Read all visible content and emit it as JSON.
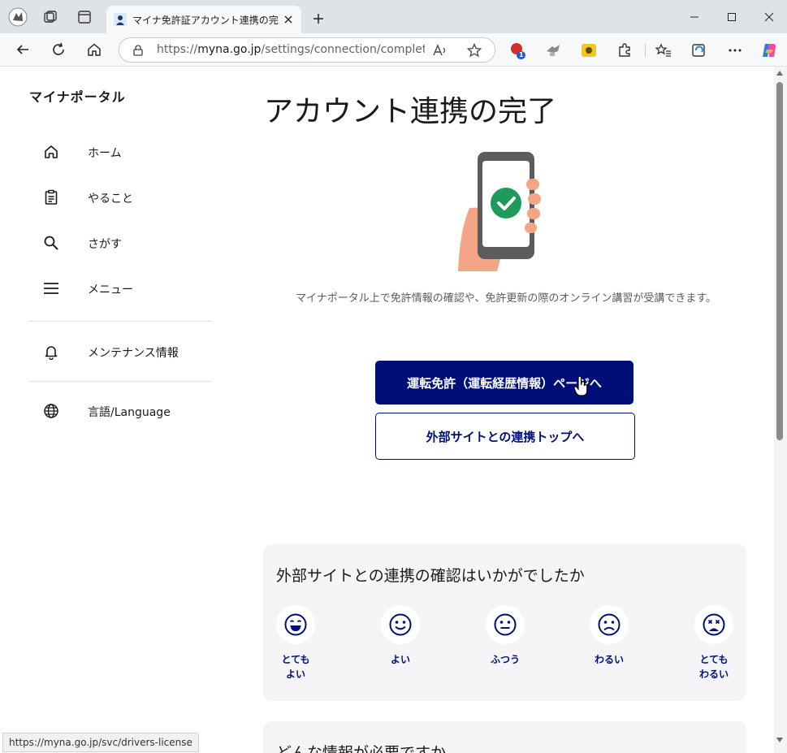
{
  "browser": {
    "tab_title": "マイナ免許証アカウント連携の完了 | マ",
    "url_prefix": "https://",
    "url_host": "myna.go.jp",
    "url_path": "/settings/connection/complete/...",
    "extension_badge": "1",
    "status_url": "https://myna.go.jp/svc/drivers-license"
  },
  "sidebar": {
    "site_name": "マイナポータル",
    "items": [
      {
        "label": "ホーム",
        "icon": "home-icon"
      },
      {
        "label": "やること",
        "icon": "clipboard-icon"
      },
      {
        "label": "さがす",
        "icon": "search-icon"
      },
      {
        "label": "メニュー",
        "icon": "menu-icon"
      }
    ],
    "maintenance": {
      "label": "メンテナンス情報",
      "icon": "bell-icon"
    },
    "language": {
      "label": "言語/Language",
      "icon": "globe-icon"
    }
  },
  "main": {
    "title": "アカウント連携の完了",
    "description": "マイナポータル上で免許情報の確認や、免許更新の際のオンライン講習が受講できます。",
    "primary_button": "運転免許（運転経歴情報）ページへ",
    "secondary_button": "外部サイトとの連携トップへ"
  },
  "survey": {
    "question": "外部サイトとの連携の確認はいかがでしたか",
    "options": [
      {
        "label": "とても\nよい",
        "icon": "very-happy-face-icon"
      },
      {
        "label": "よい",
        "icon": "happy-face-icon"
      },
      {
        "label": "ふつう",
        "icon": "neutral-face-icon"
      },
      {
        "label": "わるい",
        "icon": "sad-face-icon"
      },
      {
        "label": "とても\nわるい",
        "icon": "very-sad-face-icon"
      }
    ]
  },
  "next_section": {
    "title": "どんな情報が必要ですか"
  },
  "colors": {
    "accent": "#000f78",
    "check_green": "#1e9b5a",
    "card_bg": "#f5f5f8"
  }
}
